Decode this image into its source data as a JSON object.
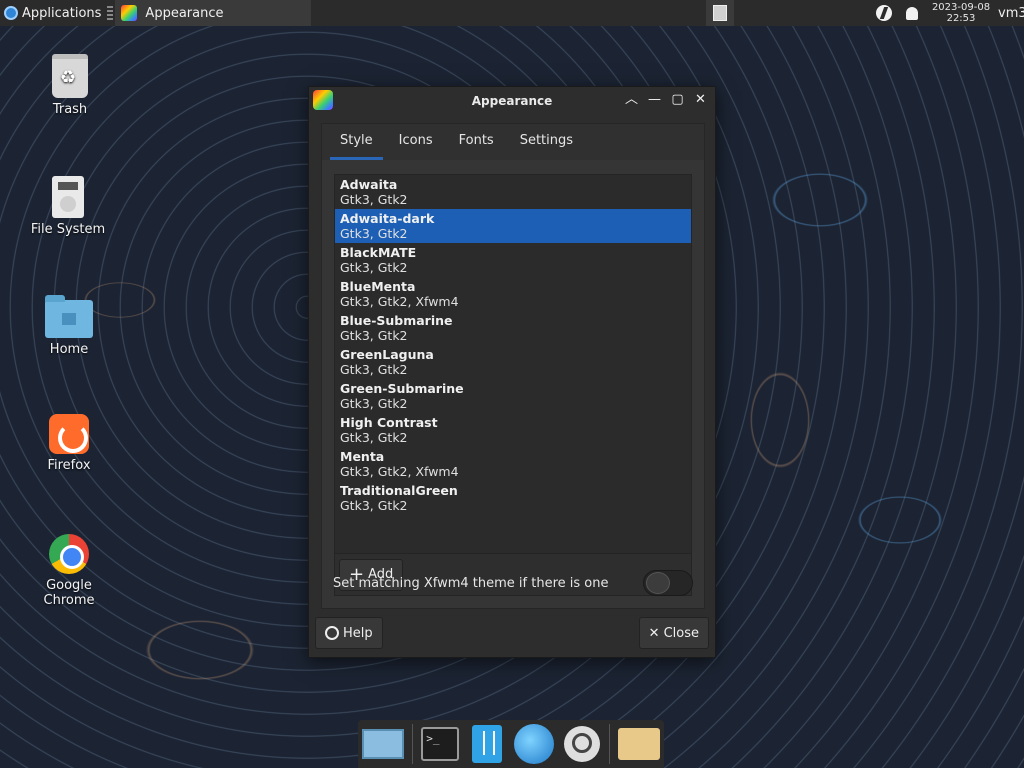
{
  "top_panel": {
    "applications_label": "Applications",
    "active_window_title": "Appearance",
    "clock_date": "2023-09-08",
    "clock_time": "22:53",
    "user_label": "vm3"
  },
  "desktop_icons": [
    {
      "label": "Trash",
      "icon": "trash-icon"
    },
    {
      "label": "File System",
      "icon": "file-system-icon"
    },
    {
      "label": "Home",
      "icon": "home-folder-icon"
    },
    {
      "label": "Firefox",
      "icon": "firefox-icon"
    },
    {
      "label": "Google Chrome",
      "icon": "chrome-icon"
    }
  ],
  "window": {
    "title": "Appearance",
    "tabs": [
      {
        "label": "Style",
        "active": true
      },
      {
        "label": "Icons",
        "active": false
      },
      {
        "label": "Fonts",
        "active": false
      },
      {
        "label": "Settings",
        "active": false
      }
    ],
    "themes": [
      {
        "name": "Adwaita",
        "sub": "Gtk3, Gtk2"
      },
      {
        "name": "Adwaita-dark",
        "sub": "Gtk3, Gtk2",
        "selected": true
      },
      {
        "name": "BlackMATE",
        "sub": "Gtk3, Gtk2"
      },
      {
        "name": "BlueMenta",
        "sub": "Gtk3, Gtk2, Xfwm4"
      },
      {
        "name": "Blue-Submarine",
        "sub": "Gtk3, Gtk2"
      },
      {
        "name": "GreenLaguna",
        "sub": "Gtk3, Gtk2"
      },
      {
        "name": "Green-Submarine",
        "sub": "Gtk3, Gtk2"
      },
      {
        "name": "High Contrast",
        "sub": "Gtk3, Gtk2"
      },
      {
        "name": "Menta",
        "sub": "Gtk3, Gtk2, Xfwm4"
      },
      {
        "name": "TraditionalGreen",
        "sub": "Gtk3, Gtk2"
      }
    ],
    "add_label": "Add",
    "xfwm_text": "Set matching Xfwm4 theme if there is one",
    "xfwm_enabled": false,
    "help_label": "Help",
    "close_label": "Close"
  },
  "dock_items": [
    "show-desktop-icon",
    "terminal-icon",
    "file-manager-icon",
    "web-browser-icon",
    "app-finder-icon",
    "folder-icon"
  ],
  "colors": {
    "selection": "#1c5fb5",
    "window_bg": "#2d2d2d",
    "panel_bg": "#2b2b2b"
  }
}
